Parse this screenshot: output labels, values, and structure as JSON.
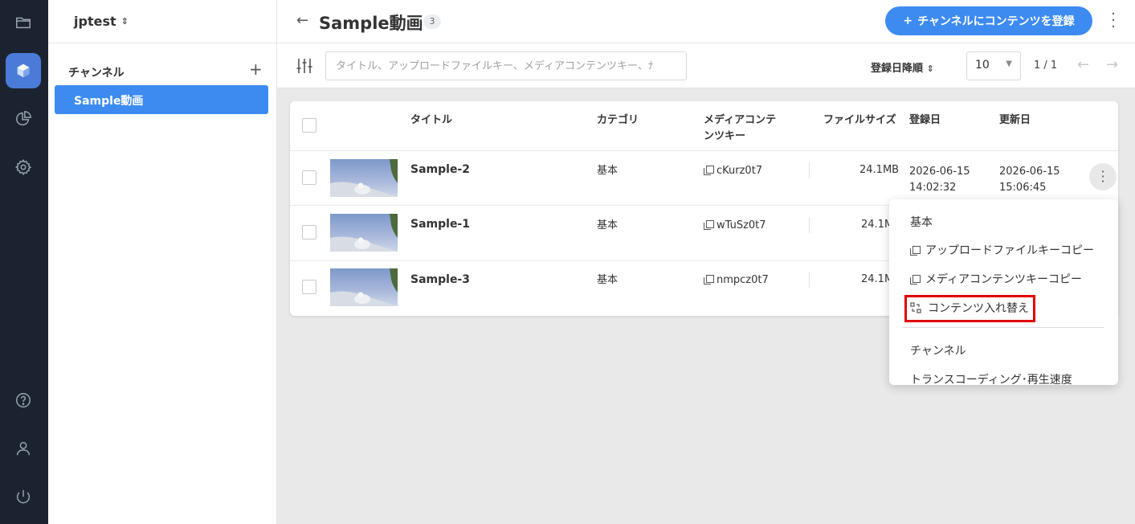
{
  "workspace": {
    "name": "jptest"
  },
  "sidebar": {
    "heading": "チャンネル",
    "add_symbol": "+",
    "items": [
      {
        "label": "Sample動画"
      }
    ]
  },
  "header": {
    "back_symbol": "←",
    "title": "Sample動画",
    "count": "3",
    "register_label": "チャンネルにコンテンツを登録",
    "register_plus": "+"
  },
  "toolbar": {
    "search_placeholder": "タイトル、アップロードファイルキー、メディアコンテンツキー、ﾅ",
    "sort_label": "登録日降順",
    "per_page": "10",
    "pager": "1 / 1"
  },
  "table": {
    "headers": {
      "title": "タイトル",
      "category": "カテゴリ",
      "media_key_1": "メディアコンテ",
      "media_key_2": "ンツキー",
      "file_size": "ファイルサイズ",
      "created": "登録日",
      "updated": "更新日"
    },
    "rows": [
      {
        "title": "Sample-2",
        "category": "基本",
        "media_key": "cKurz0t7",
        "size": "24.1MB",
        "created_date": "2026-06-15",
        "created_time": "14:02:32",
        "updated_date": "2026-06-15",
        "updated_time": "15:06:45"
      },
      {
        "title": "Sample-1",
        "category": "基本",
        "media_key": "wTuSz0t7",
        "size": "24.1M"
      },
      {
        "title": "Sample-3",
        "category": "基本",
        "media_key": "nmpcz0t7",
        "size": "24.1M"
      }
    ]
  },
  "menu": {
    "basic": "基本",
    "copy_upload_key": "アップロードファイルキーコピー",
    "copy_media_key": "メディアコンテンツキーコピー",
    "replace_content": "コンテンツ入れ替え",
    "channel": "チャンネル",
    "transcoding": "トランスコーディング･再生速度"
  },
  "colors": {
    "accent": "#3d8bf1",
    "rail": "#1c2330",
    "highlight": "#e00000"
  }
}
